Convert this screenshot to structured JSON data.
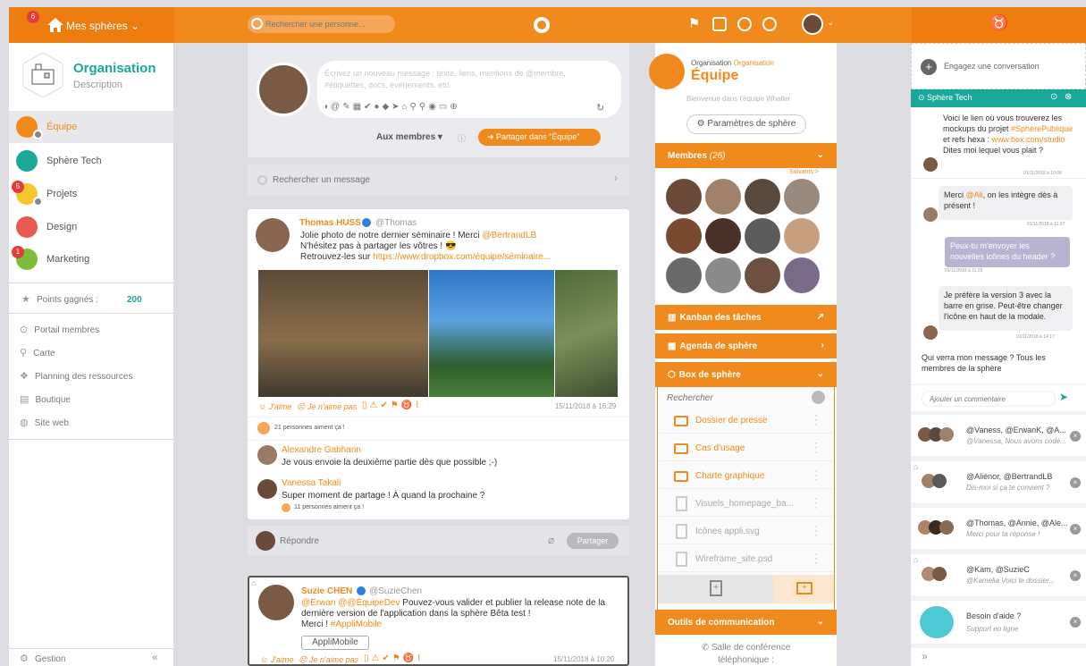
{
  "topbar": {
    "spheres_label": "Mes sphères",
    "spheres_badge": "6",
    "search_placeholder": "Rechercher une personne..."
  },
  "sidebar": {
    "org_name": "Organisation",
    "org_desc": "Description",
    "spheres": [
      {
        "label": "Équipe",
        "color": "#f18a1c",
        "badge": ""
      },
      {
        "label": "Sphère Tech",
        "color": "#1aa89a",
        "badge": ""
      },
      {
        "label": "Projets",
        "color": "#f5c72c",
        "badge": "5"
      },
      {
        "label": "Design",
        "color": "#e85a4f",
        "badge": ""
      },
      {
        "label": "Marketing",
        "color": "#7dbd3a",
        "badge": "1"
      }
    ],
    "points_label": "Points gagnés :",
    "points_value": "200",
    "links": [
      {
        "label": "Portail membres",
        "icon": "portal-icon"
      },
      {
        "label": "Carte",
        "icon": "map-pin-icon"
      },
      {
        "label": "Planning des ressources",
        "icon": "resources-icon"
      },
      {
        "label": "Boutique",
        "icon": "shop-icon"
      },
      {
        "label": "Site web",
        "icon": "globe-icon"
      }
    ],
    "footer_label": "Gestion"
  },
  "composer": {
    "placeholder": "Écrivez un nouveau message : texte, liens, mentions de @membre, #étiquettes, docs, événements, etc.",
    "audience": "Aux membres",
    "share_button": "Partager dans \"Équipe\""
  },
  "msg_search_placeholder": "Rechercher un message",
  "post1": {
    "author": "Thomas HUSS",
    "handle": "@Thomas",
    "line1_pre": "Jolie photo de notre dernier séminaire ! Merci ",
    "line1_mention": "@BertrandLB",
    "line2": "N'hésitez pas à partager les vôtres ! 😎",
    "line3_pre": "Retrouvez-les sur ",
    "line3_link": "https://www.dropbox.com/équipe/séminaire...",
    "like": "J'aime",
    "dislike": "Je n'aime pas",
    "date": "15/11/2018 à 16:29",
    "likes_text": "21 personnes aiment ça !"
  },
  "comments": [
    {
      "author": "Alexandre Gabhann",
      "text": "Je vous envoie la deuxième partie dès que possible ;-)",
      "likes": ""
    },
    {
      "author": "Vanessa Takali",
      "text": "Super moment de partage ! À quand la prochaine ?",
      "likes": "11 personnes aiment ça !"
    }
  ],
  "reply": {
    "placeholder": "Répondre",
    "button": "Partager"
  },
  "post2": {
    "author": "Suzie CHEN",
    "handle": "@SuzieChen",
    "mention": "@Erwan @@ÉquipeDev",
    "line1": "Pouvez-vous valider et publier la release note de la dernière version de l'application dans la sphère Bêta test !",
    "line2_pre": "Merci ! ",
    "line2_tag": "#AppliMobile",
    "tag": "AppliMobile",
    "like": "J'aime",
    "dislike": "Je n'aime pas",
    "date": "15/11/2018 à 10:20"
  },
  "sphere_panel": {
    "org_prefix": "Organisation",
    "org_name": "Organisation",
    "title": "Équipe",
    "welcome": "Bienvenue dans l'équipe Whaller",
    "settings": "Paramètres de sphère",
    "members_label": "Membres",
    "members_count": "(26)",
    "next": "Suivants >",
    "kanban": "Kanban des tâches",
    "agenda": "Agenda de sphère",
    "box": "Box de sphère",
    "box_search": "Rechercher",
    "folders": [
      "Dossier de presse",
      "Cas d'usage",
      "Charte graphique"
    ],
    "files": [
      "Visuels_homepage_ba...",
      "Icônes appli.svg",
      "Wireframe_site.psd"
    ],
    "comm": "Outils de communication",
    "conf1": "Salle de conférence",
    "conf2": "téléphonique :"
  },
  "chat": {
    "start": "Engagez une conversation",
    "header": "Sphère Tech",
    "m1": {
      "text_pre": "Voici le lien où vous trouverez les mockups du projet ",
      "tag": "#SphèrePublique",
      "text_mid": " et refs hexa : ",
      "link": "www.box.com/studio",
      "text_end": "Dites moi lequel vous plait ?",
      "time": "01/11/2018 à 10:08"
    },
    "m2": {
      "pre": "Merci ",
      "mention": "@Ali",
      "post": ", on les intègre dès à présent !",
      "time": "01/11/2018 à 11:07"
    },
    "m3": {
      "text": "Peux-tu m'envoyer les nouvelles icônes du header ?",
      "time": "01/11/2018 à 11:25"
    },
    "m4": {
      "text": "Je préfère la version 3 avec la barre en grise. Peut-être changer l'icône en haut de la modale.",
      "time": "01/11/2018 à 14:17"
    },
    "m5": "Qui verra mon message ? Tous les membres de la sphère",
    "comment_placeholder": "Ajouter un commentaire",
    "convs": [
      {
        "names": "@Vaness, @ErwanK, @A...",
        "sub": "@Vanessa, Nous avons codé..."
      },
      {
        "names": "@Aliénor, @BertrandLB",
        "sub": "Dis-moi si ça te convient ?"
      },
      {
        "names": "@Thomas, @Annie, @Ale...",
        "sub": "Merci pour ta réponse !"
      },
      {
        "names": "@Kam, @SuzieC",
        "sub": "@Kamelia Voici le dossier..."
      },
      {
        "names": "Besoin d'aide ?",
        "sub": "Support en ligne"
      }
    ]
  },
  "colors": {
    "accent": "#f18a1c",
    "teal": "#1aa89a",
    "bg": "#dcdce1"
  }
}
